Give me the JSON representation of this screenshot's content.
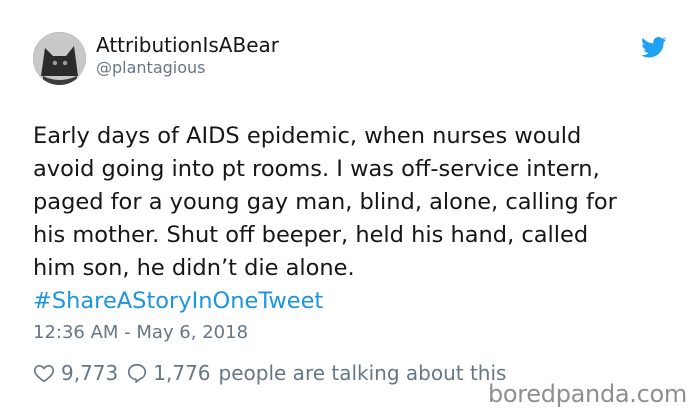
{
  "tweet": {
    "display_name": "AttributionIsABear",
    "handle": "@plantagious",
    "avatar_icon": "avatar-cat-icon",
    "brand_icon": "twitter-bird-icon",
    "brand_color": "#1da1f2",
    "hashtag_color": "#1b95e0",
    "text_lines": [
      "Early days of AIDS epidemic, when nurses would",
      "avoid going into pt rooms. I was off-service intern,",
      "paged for a young gay man, blind, alone, calling for",
      "his mother. Shut off beeper, held his hand, called",
      "him son, he didn’t die alone."
    ],
    "hashtag": "#ShareAStoryInOneTweet",
    "timestamp": "12:36 AM - May 6, 2018",
    "likes": "9,773",
    "replies": "1,776",
    "talking_label": "people are talking about this"
  },
  "watermark": "boredpanda.com"
}
